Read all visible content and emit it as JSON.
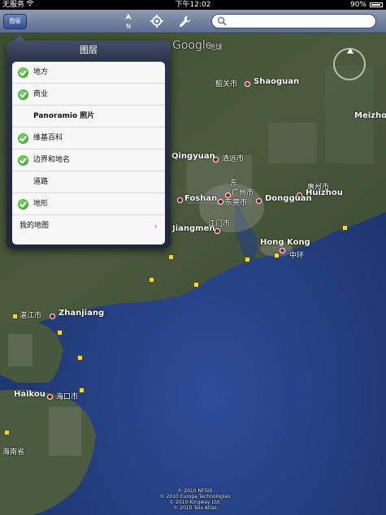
{
  "status_bar": {
    "carrier": "无服务",
    "wifi_icon": "wifi-icon",
    "time": "下午12:02",
    "battery_percent": "90%",
    "battery_icon": "battery-icon"
  },
  "toolbar": {
    "layers_button_label": "图层",
    "compass_label": "N",
    "location_icon": "location-icon",
    "settings_icon": "wrench-icon",
    "search_icon": "search-icon",
    "search_value": ""
  },
  "layers_popover": {
    "title": "图层",
    "items": [
      {
        "label": "地方",
        "checked": true
      },
      {
        "label": "商业",
        "checked": true
      },
      {
        "label": "Panoramio 照片",
        "checked": false
      },
      {
        "label": "维基百科",
        "checked": true
      },
      {
        "label": "边界和地名",
        "checked": true
      },
      {
        "label": "道路",
        "checked": false
      },
      {
        "label": "地形",
        "checked": true
      }
    ],
    "my_maps_label": "我的地图"
  },
  "map": {
    "google_watermark": "Google",
    "earth_label": "地球",
    "places": [
      {
        "name_zh": "韶关市",
        "name_en": "Shaoguan"
      },
      {
        "name_zh": "清远市",
        "name_en": "Qingyuan"
      },
      {
        "name_zh": "东莞市",
        "name_en": "Dongguan"
      },
      {
        "name_zh": "惠州市",
        "name_en": "Huizhou"
      },
      {
        "name_zh": "",
        "name_en": "Foshan"
      },
      {
        "name_zh": "江门市",
        "name_en": "Jiangmen"
      },
      {
        "name_zh": "",
        "name_en": "Hong Kong"
      },
      {
        "name_zh": "中环",
        "name_en": ""
      },
      {
        "name_zh": "湛江市",
        "name_en": "Zhanjiang"
      },
      {
        "name_zh": "海口市",
        "name_en": "Haikou"
      },
      {
        "name_zh": "",
        "name_en": "Meizhou"
      },
      {
        "name_zh": "海南省",
        "name_en": ""
      },
      {
        "name_zh": "东",
        "name_en": ""
      },
      {
        "name_zh": "广州市",
        "name_en": ""
      }
    ],
    "copyright": [
      "© 2010 NFGIS",
      "© 2010 Europa Technologies",
      "© 2010 Kingway Ltd.",
      "© 2010 Tele Atlas"
    ]
  },
  "colors": {
    "toolbar_top": "#8e9bb3",
    "toolbar_bottom": "#5c6d8d",
    "popover_bg": "#2a3449",
    "check_green": "#2e9a2a",
    "ocean": "#1f3a78",
    "pin_red": "#8a1020"
  }
}
